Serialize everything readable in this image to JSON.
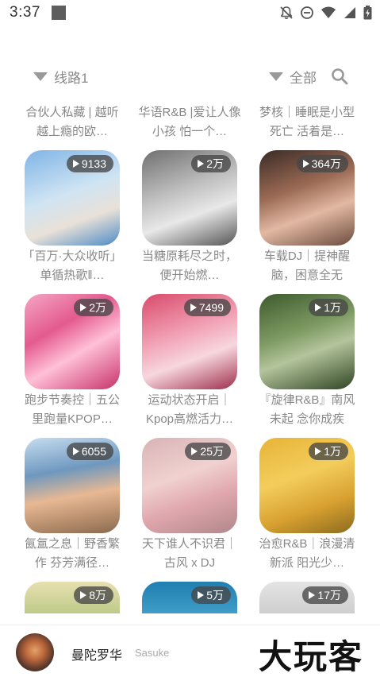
{
  "status_bar": {
    "time": "3:37",
    "icons": [
      "mute-bell-icon",
      "dnd-icon",
      "wifi-icon",
      "signal-icon",
      "battery-icon"
    ]
  },
  "filter": {
    "line_label": "线路1",
    "category_label": "全部"
  },
  "playlists": [
    {
      "title": "合伙人私藏 | 越听越上瘾的欧…",
      "plays": ""
    },
    {
      "title": "华语R&B |爱让人像小孩 怕一个…",
      "plays": ""
    },
    {
      "title": "梦核｜睡眠是小型死亡 活着是…",
      "plays": ""
    },
    {
      "title": "「百万·大众收听」单循热歌‖…",
      "plays": "9133"
    },
    {
      "title": "当糖原耗尽之时，便开始燃…",
      "plays": "2万"
    },
    {
      "title": "车载DJ｜提神醒脑，困意全无",
      "plays": "364万"
    },
    {
      "title": "跑步节奏控｜五公里跑量KPOP…",
      "plays": "2万"
    },
    {
      "title": "运动状态开启｜Kpop高燃活力…",
      "plays": "7499"
    },
    {
      "title": "『旋律R&B』南风未起 念你成疾",
      "plays": "1万"
    },
    {
      "title": "氤氲之息｜野香繁作 芬芳满径…",
      "plays": "6055"
    },
    {
      "title": "天下谁人不识君｜古风 x DJ",
      "plays": "25万"
    },
    {
      "title": "治愈R&B｜浪漫清新派 阳光少…",
      "plays": "1万"
    },
    {
      "title": "",
      "plays": "8万"
    },
    {
      "title": "",
      "plays": "5万"
    },
    {
      "title": "",
      "plays": "17万"
    }
  ],
  "player": {
    "title": "曼陀罗华",
    "artist": "Sasuke"
  },
  "watermark": "大玩客"
}
